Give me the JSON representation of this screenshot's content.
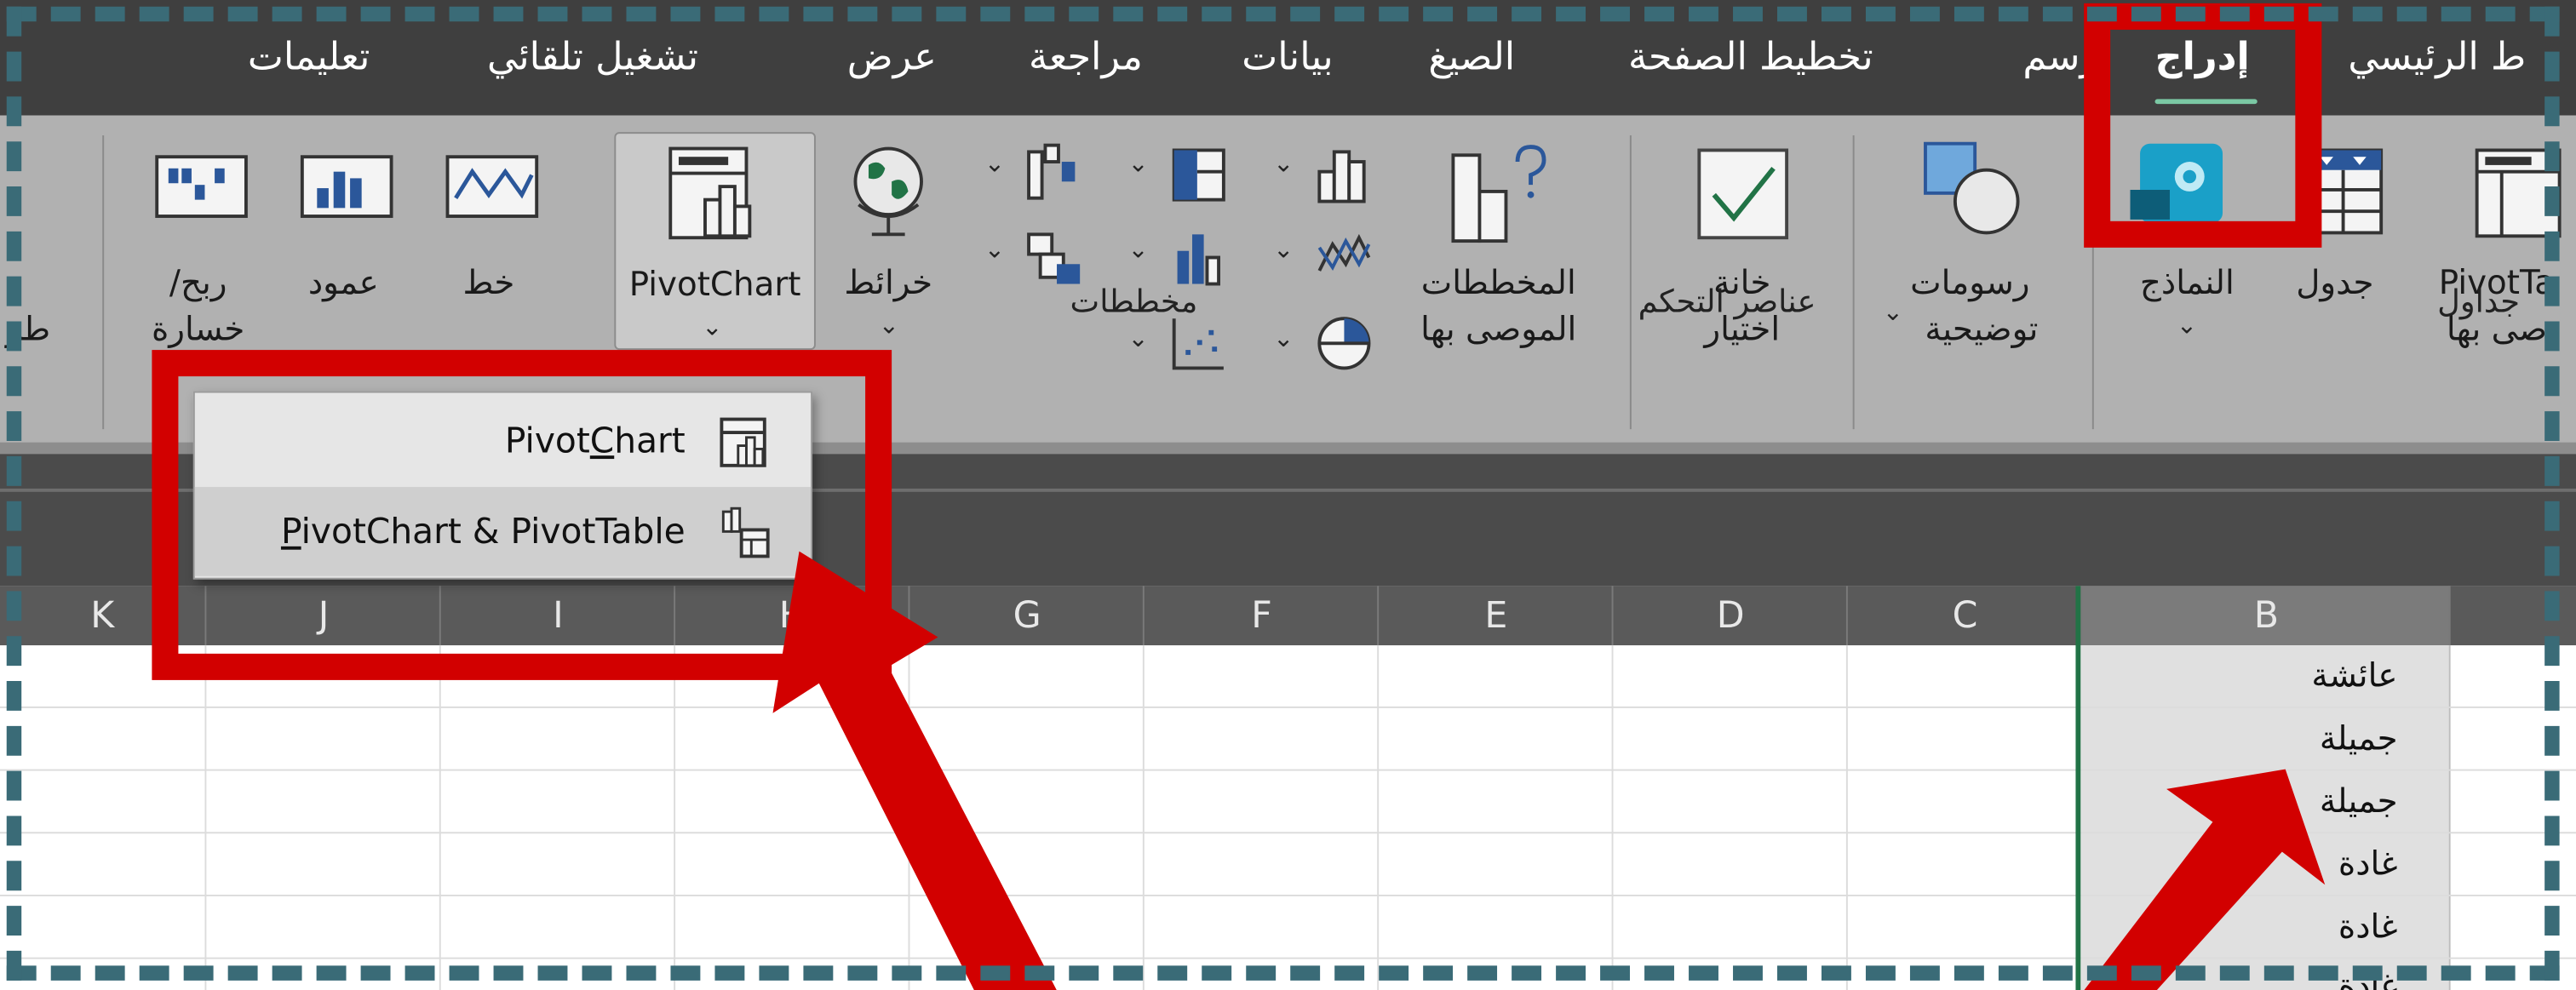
{
  "tabs": [
    {
      "label": "تعليمات"
    },
    {
      "label": "تشغيل تلقائي"
    },
    {
      "label": "عرض"
    },
    {
      "label": "مراجعة"
    },
    {
      "label": "بيانات"
    },
    {
      "label": "الصيغ"
    },
    {
      "label": "تخطيط الصفحة"
    },
    {
      "label": "رسم"
    },
    {
      "label": "إدراج",
      "active": true
    },
    {
      "label": "ط الرئيسي"
    }
  ],
  "ribbon": {
    "groups": {
      "tables": "جداول",
      "controls": "عناصر التحكم",
      "charts": "مخططات"
    },
    "buttons": {
      "pivottable": [
        "PivotTa",
        "صى بها"
      ],
      "table": "جدول",
      "templates": "النماذج",
      "illustrations": [
        "رسومات",
        "توضيحية"
      ],
      "checkbox": [
        "خانة",
        "اختيار"
      ],
      "recommended_charts": [
        "المخططات",
        "الموصى بها"
      ],
      "maps": "خرائط",
      "pivotchart": "PivotChart",
      "sparkline_line": "خط",
      "sparkline_column": "عمود",
      "sparkline_winloss": [
        "ربح/",
        "خسارة"
      ],
      "cut_label": "طر"
    }
  },
  "dropdown": {
    "items": [
      {
        "label": "PivotChart",
        "underline": "C"
      },
      {
        "label": "PivotChart & PivotTable",
        "underline": "P"
      }
    ]
  },
  "columns": [
    "K",
    "J",
    "I",
    "H",
    "G",
    "F",
    "E",
    "D",
    "C",
    "B"
  ],
  "cells": [
    "عائشة",
    "جميلة",
    "جميلة",
    "غادة",
    "غادة",
    "غادة"
  ],
  "colors": {
    "annotation_red": "#d20000",
    "frame_dash": "#3a6b77",
    "active_tab_underline": "#7bc8a4",
    "selection_edge": "#217346"
  },
  "icons": {
    "pivottable": "pivottable-icon",
    "table": "table-icon",
    "templates": "templates-icon",
    "illustrations": "shapes-icon",
    "checkbox": "checkbox-icon",
    "recommended_charts": "recommended-charts-icon",
    "maps": "globe-icon",
    "pivotchart": "pivotchart-icon",
    "sparkline_line": "sparkline-line-icon",
    "sparkline_column": "sparkline-column-icon",
    "sparkline_winloss": "sparkline-winloss-icon"
  }
}
